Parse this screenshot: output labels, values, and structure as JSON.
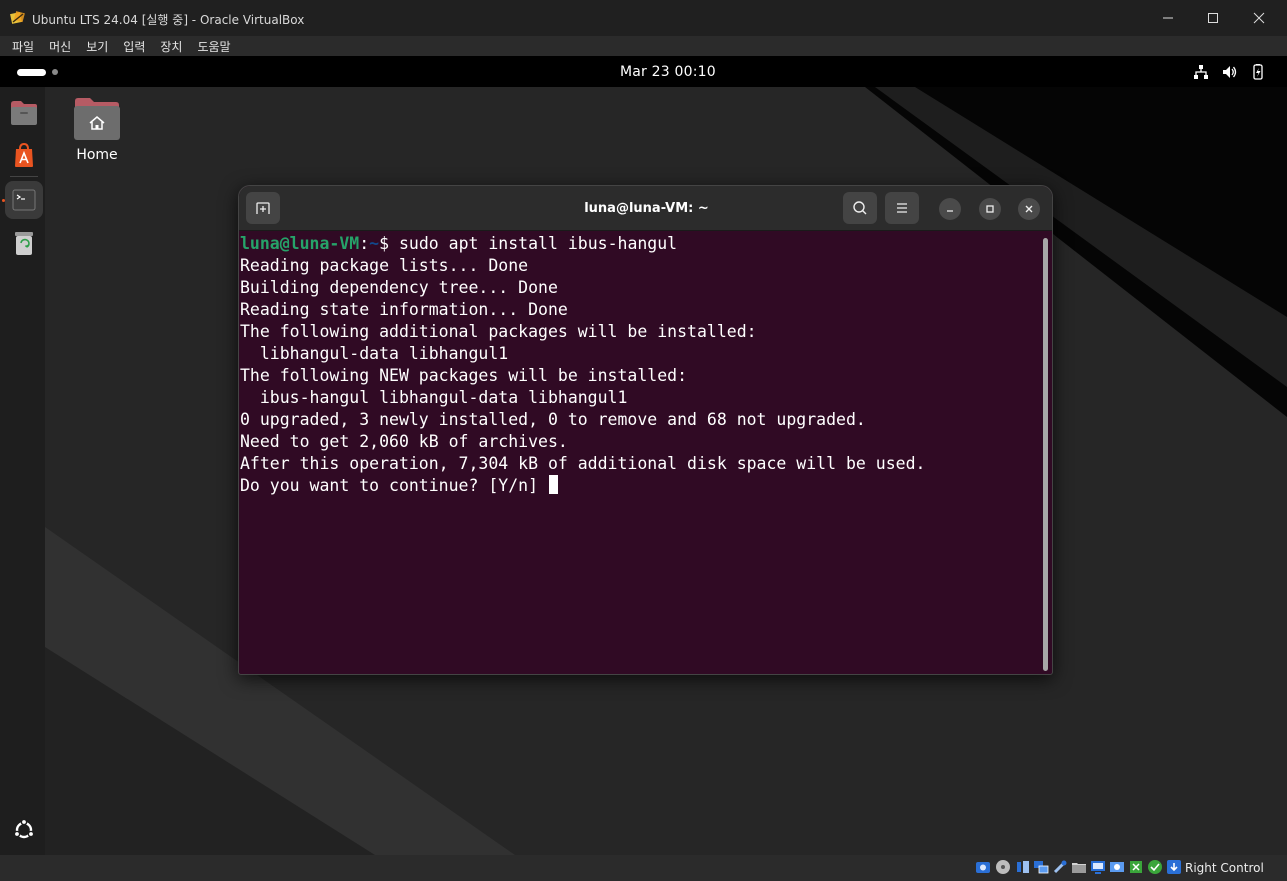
{
  "window": {
    "title": "Ubuntu LTS 24.04 [실행 중] - Oracle VirtualBox"
  },
  "menubar": {
    "items": [
      "파일",
      "머신",
      "보기",
      "입력",
      "장치",
      "도움말"
    ]
  },
  "topbar": {
    "clock": "Mar 23  00:10",
    "tray_icons": [
      "network-icon",
      "volume-icon",
      "battery-icon"
    ]
  },
  "dock": {
    "items": [
      {
        "name": "files",
        "icon": "folder-icon"
      },
      {
        "name": "app-center",
        "icon": "app-center-icon"
      },
      {
        "name": "terminal",
        "icon": "terminal-icon",
        "active": true
      },
      {
        "name": "trash",
        "icon": "trash-icon"
      },
      {
        "name": "show-apps",
        "icon": "ubuntu-logo-icon"
      }
    ]
  },
  "desktop": {
    "home_label": "Home"
  },
  "terminal": {
    "title": "luna@luna-VM: ~",
    "prompt_user": "luna@luna-VM",
    "prompt_sep": ":",
    "prompt_path": "~",
    "prompt_symbol": "$",
    "command": " sudo apt install ibus-hangul",
    "lines": [
      "Reading package lists... Done",
      "Building dependency tree... Done",
      "Reading state information... Done",
      "The following additional packages will be installed:",
      "  libhangul-data libhangul1",
      "The following NEW packages will be installed:",
      "  ibus-hangul libhangul-data libhangul1",
      "0 upgraded, 3 newly installed, 0 to remove and 68 not upgraded.",
      "Need to get 2,060 kB of archives.",
      "After this operation, 7,304 kB of additional disk space will be used."
    ],
    "question": "Do you want to continue? [Y/n] ",
    "colors": {
      "background": "#300a24",
      "prompt_user": "#26a269",
      "prompt_path": "#12488b"
    }
  },
  "statusbar": {
    "host_key": "Right Control"
  }
}
